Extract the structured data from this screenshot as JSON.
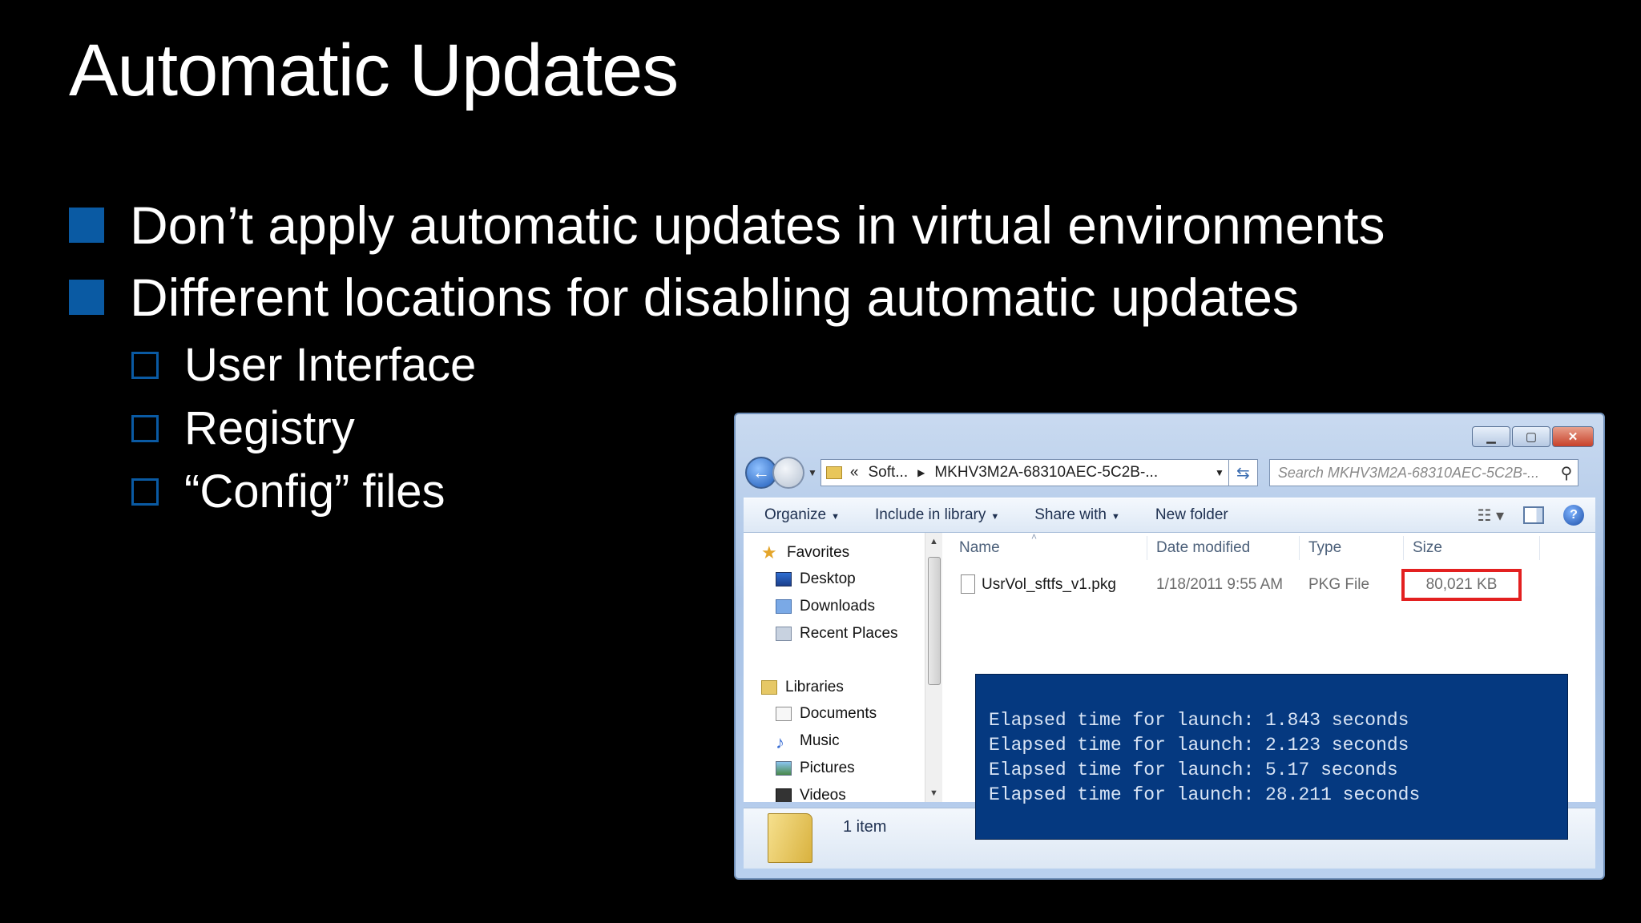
{
  "slide": {
    "title": "Automatic Updates",
    "bullets": [
      "Don’t apply automatic updates in virtual environments",
      "Different locations for disabling automatic updates"
    ],
    "sub_bullets": [
      "User Interface",
      "Registry",
      "“Config” files"
    ]
  },
  "explorer": {
    "breadcrumb_prefix": "«",
    "breadcrumb": [
      "Soft...",
      "MKHV3M2A-68310AEC-5C2B-..."
    ],
    "search_placeholder": "Search MKHV3M2A-68310AEC-5C2B-...",
    "toolbar": {
      "organize": "Organize",
      "include": "Include in library",
      "share": "Share with",
      "new_folder": "New folder"
    },
    "nav": {
      "favorites": "Favorites",
      "desktop": "Desktop",
      "downloads": "Downloads",
      "recent": "Recent Places",
      "libraries": "Libraries",
      "documents": "Documents",
      "music": "Music",
      "pictures": "Pictures",
      "videos": "Videos"
    },
    "columns": {
      "name": "Name",
      "date": "Date modified",
      "type": "Type",
      "size": "Size"
    },
    "file": {
      "name": "UsrVol_sftfs_v1.pkg",
      "date": "1/18/2011 9:55 AM",
      "type": "PKG File",
      "size": "80,021 KB"
    },
    "item_count": "1 item"
  },
  "console": {
    "lines": [
      "Elapsed time for launch: 1.843 seconds",
      "Elapsed time for launch: 2.123 seconds",
      "Elapsed time for launch: 5.17 seconds",
      "Elapsed time for launch: 28.211 seconds"
    ]
  },
  "colors": {
    "bullet": "#0a5aa3",
    "highlight": "#e32020",
    "console_bg": "#053980"
  }
}
